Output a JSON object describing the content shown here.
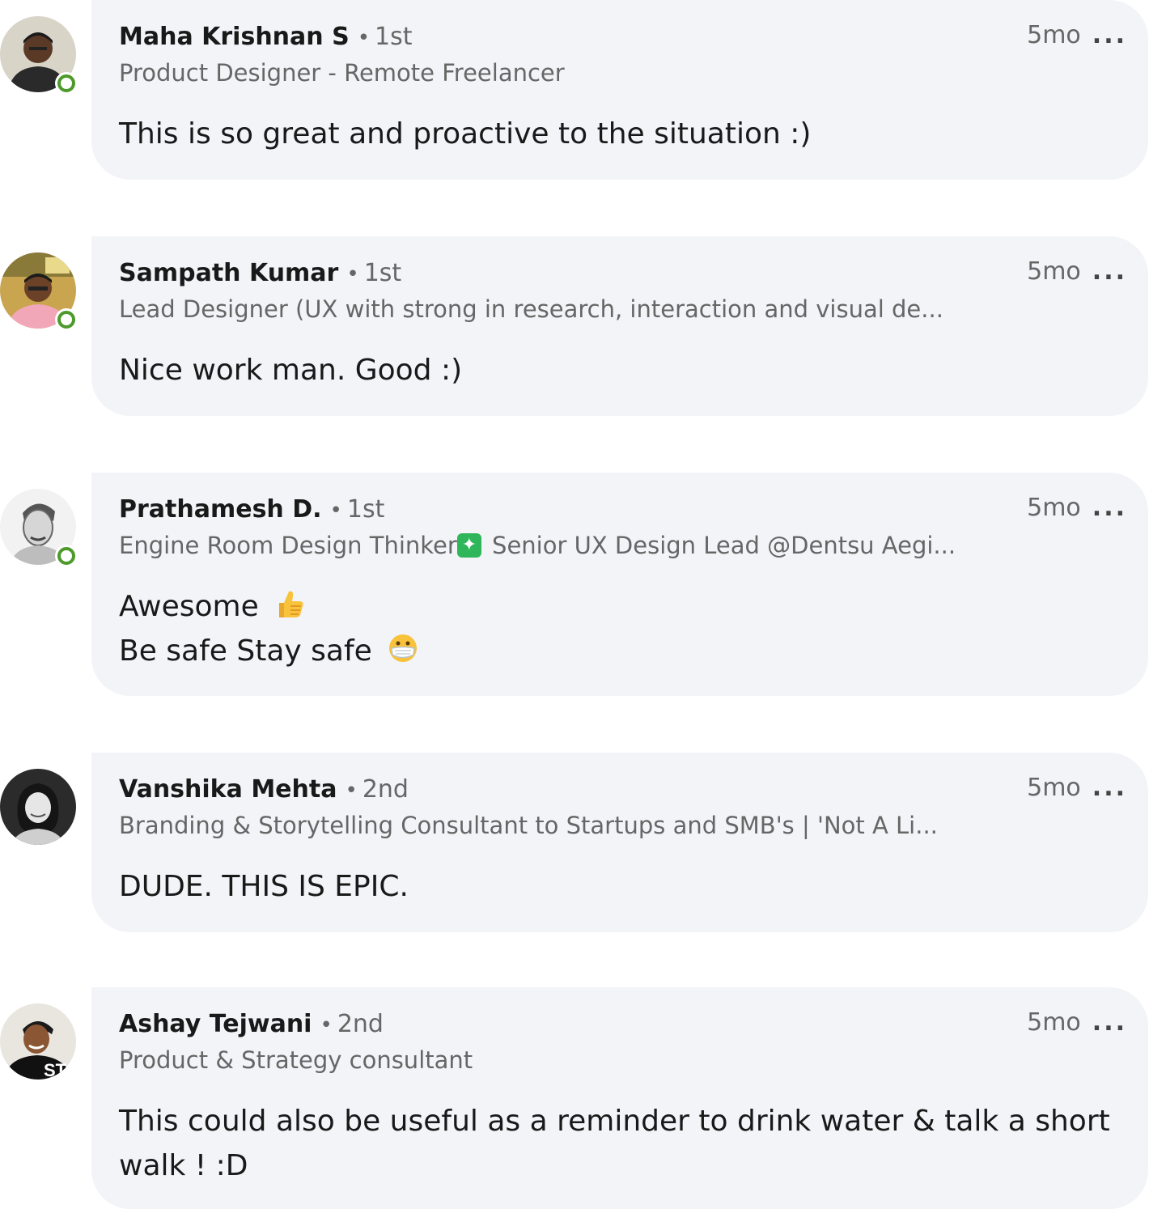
{
  "comments": [
    {
      "name": "Maha Krishnan S",
      "separator": "•",
      "degree": "1st",
      "headline": "Product Designer - Remote Freelancer",
      "time": "5mo",
      "more": "...",
      "lines": [
        "This is so great and proactive to the situation :)"
      ],
      "online": true
    },
    {
      "name": "Sampath Kumar",
      "separator": "•",
      "degree": "1st",
      "headline": "Lead Designer (UX with strong in research, interaction and visual de...",
      "time": "5mo",
      "more": "...",
      "lines": [
        "Nice work man. Good :)"
      ],
      "online": true
    },
    {
      "name": "Prathamesh D.",
      "separator": "•",
      "degree": "1st",
      "headline_part1": "Engine Room Design Thinker",
      "headline_part2": " Senior UX Design Lead @Dentsu Aegi...",
      "time": "5mo",
      "more": "...",
      "lines": [
        "Awesome",
        "Be safe Stay safe"
      ],
      "emojis": [
        "thumbs-up-emoji",
        "face-with-mask-emoji"
      ],
      "online": true
    },
    {
      "name": "Vanshika Mehta",
      "separator": "•",
      "degree": "2nd",
      "headline": "Branding & Storytelling Consultant to Startups and SMB's | 'Not A Li...",
      "time": "5mo",
      "more": "...",
      "lines": [
        "DUDE. THIS IS EPIC."
      ],
      "online": false
    },
    {
      "name": "Ashay Tejwani",
      "separator": "•",
      "degree": "2nd",
      "headline": "Product & Strategy consultant",
      "time": "5mo",
      "more": "...",
      "lines": [
        "This could also be useful as a reminder to drink water & talk a short",
        "walk ! :D"
      ],
      "online": false
    }
  ]
}
